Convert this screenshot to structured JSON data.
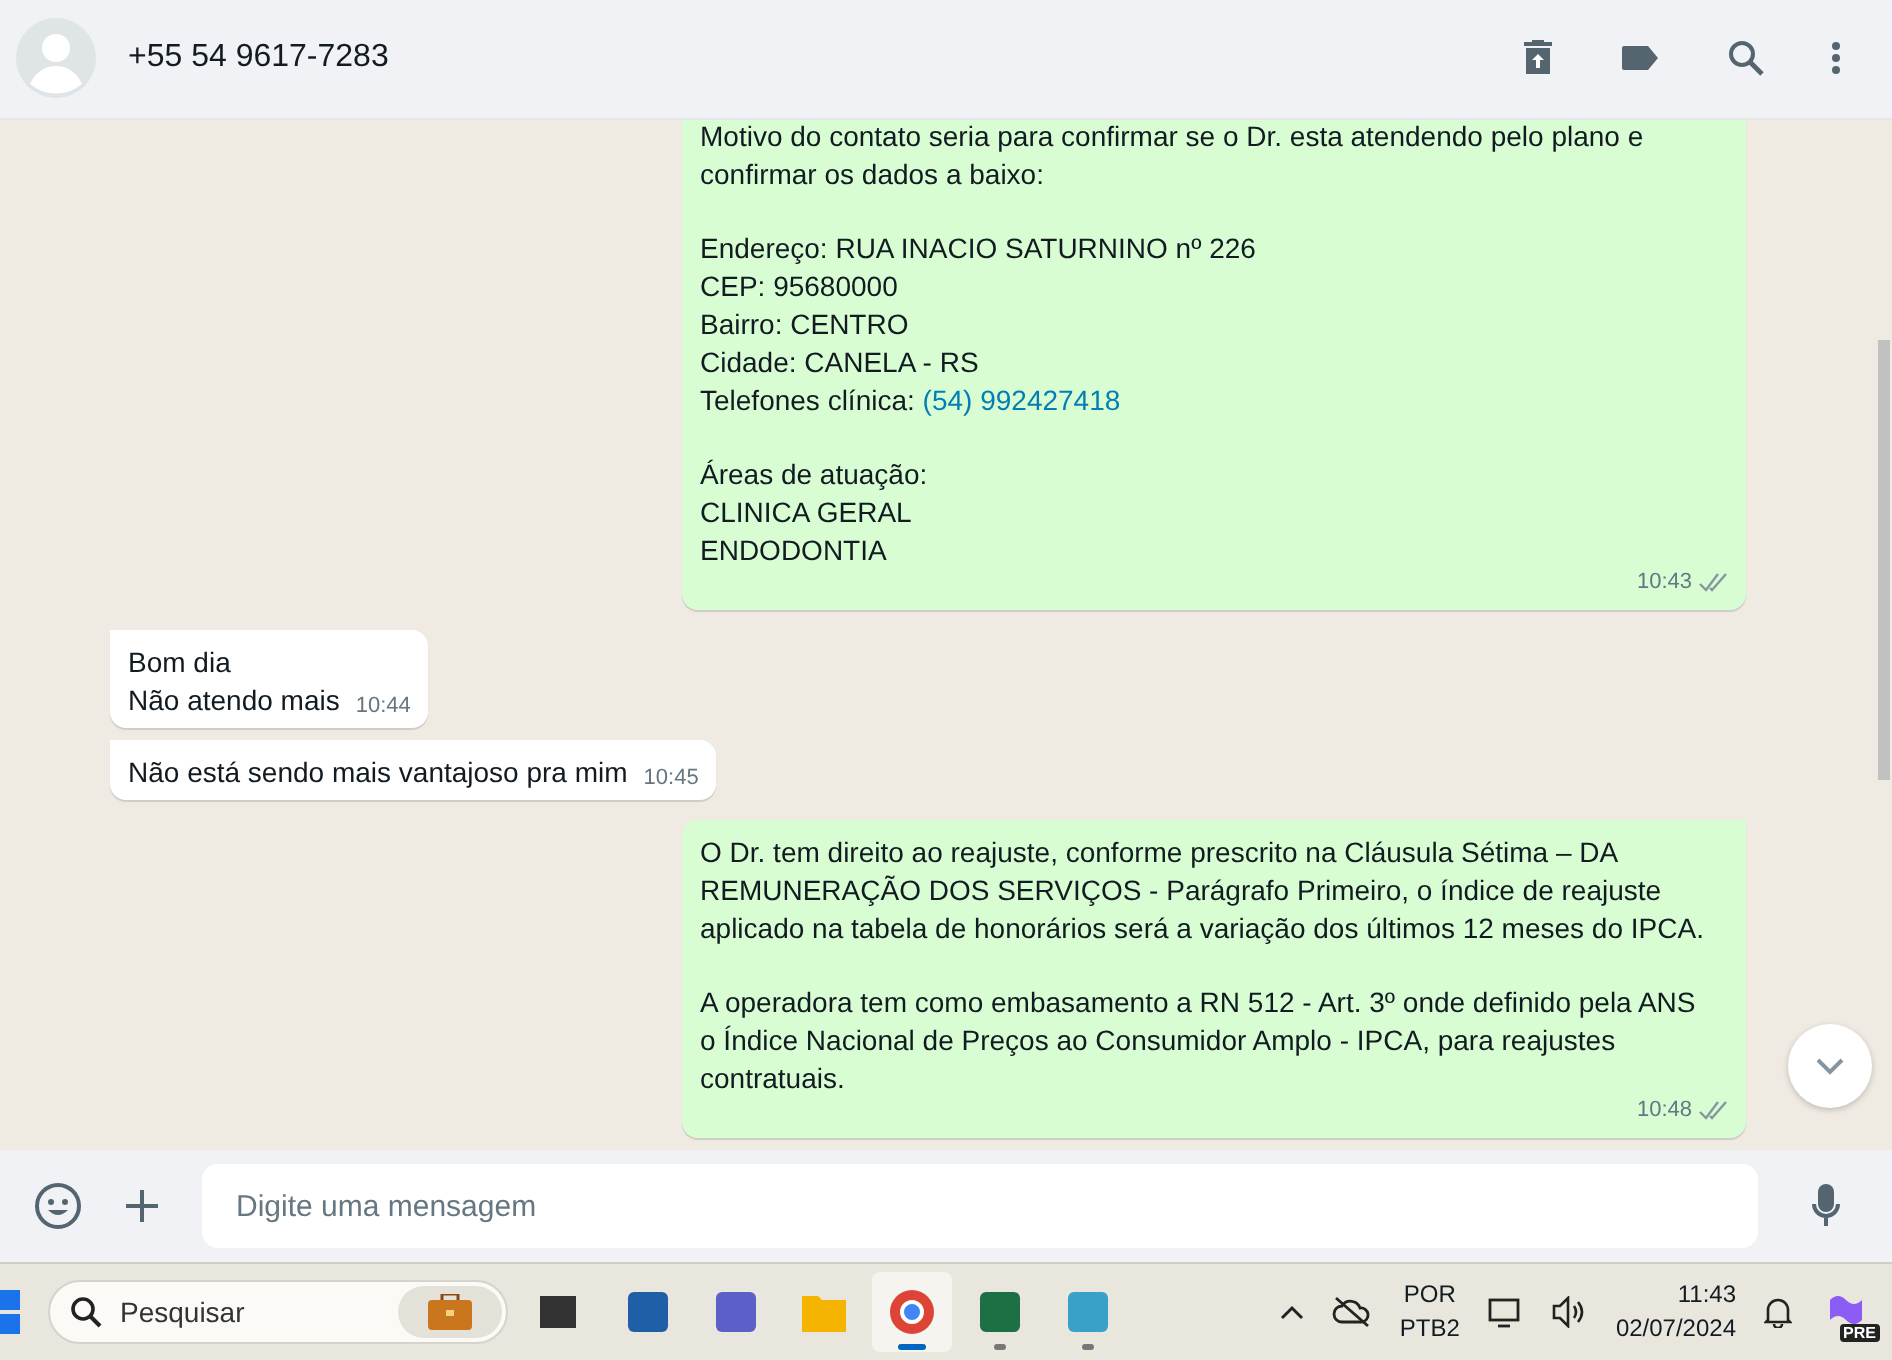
{
  "header": {
    "contact": "+55 54 9617-7283"
  },
  "messages": [
    {
      "kind": "out",
      "blocks": [
        [
          {
            "text": "Motivo do contato seria para confirmar se o Dr. esta atendendo pelo plano e"
          },
          {
            "text": "confirmar os dados a baixo:"
          }
        ],
        [
          {
            "text": "Endereço: RUA INACIO SATURNINO nº 226"
          },
          {
            "text": "CEP: 95680000"
          },
          {
            "text": "Bairro: CENTRO"
          },
          {
            "text": "Cidade: CANELA - RS"
          },
          {
            "text": "Telefones clínica: ",
            "link": "(54) 992427418"
          }
        ],
        [
          {
            "text": "Áreas de atuação:"
          },
          {
            "text": "CLINICA GERAL"
          },
          {
            "text": "ENDODONTIA"
          }
        ]
      ],
      "time": "10:43",
      "read": false
    },
    {
      "kind": "in",
      "blocks": [
        [
          {
            "text": "Bom dia"
          },
          {
            "text": "Não atendo mais"
          }
        ]
      ],
      "time": "10:44"
    },
    {
      "kind": "in",
      "blocks": [
        [
          {
            "text": "Não está sendo mais vantajoso pra mim"
          }
        ]
      ],
      "time": "10:45"
    },
    {
      "kind": "out",
      "blocks": [
        [
          {
            "text": "O Dr. tem direito ao reajuste, conforme prescrito na Cláusula Sétima – DA"
          },
          {
            "text": "REMUNERAÇÃO DOS SERVIÇOS - Parágrafo Primeiro, o índice de reajuste"
          },
          {
            "text": "aplicado na tabela de honorários será a variação dos últimos 12 meses do IPCA."
          }
        ],
        [
          {
            "text": "A operadora tem como embasamento a RN 512 - Art. 3º onde definido pela ANS"
          },
          {
            "text": "o Índice Nacional de Preços ao Consumidor Amplo - IPCA, para reajustes"
          },
          {
            "text": "contratuais."
          }
        ]
      ],
      "time": "10:48",
      "read": false
    }
  ],
  "composer": {
    "placeholder": "Digite uma mensagem"
  },
  "taskbar": {
    "search": {
      "placeholder": "Pesquisar"
    },
    "apps": [
      {
        "kind": "desktop",
        "running": false,
        "selected": false
      },
      {
        "kind": "store",
        "running": false,
        "selected": false
      },
      {
        "kind": "teams",
        "running": false,
        "selected": false
      },
      {
        "kind": "folder",
        "running": false,
        "selected": false
      },
      {
        "kind": "browser",
        "running": true,
        "selected": true
      },
      {
        "kind": "sheet",
        "running": true,
        "selected": false
      },
      {
        "kind": "notepad",
        "running": true,
        "selected": false
      }
    ],
    "language": [
      "POR",
      "PTB2"
    ],
    "time": "11:43",
    "date": "02/07/2024",
    "copilot_badge": "PRE"
  }
}
